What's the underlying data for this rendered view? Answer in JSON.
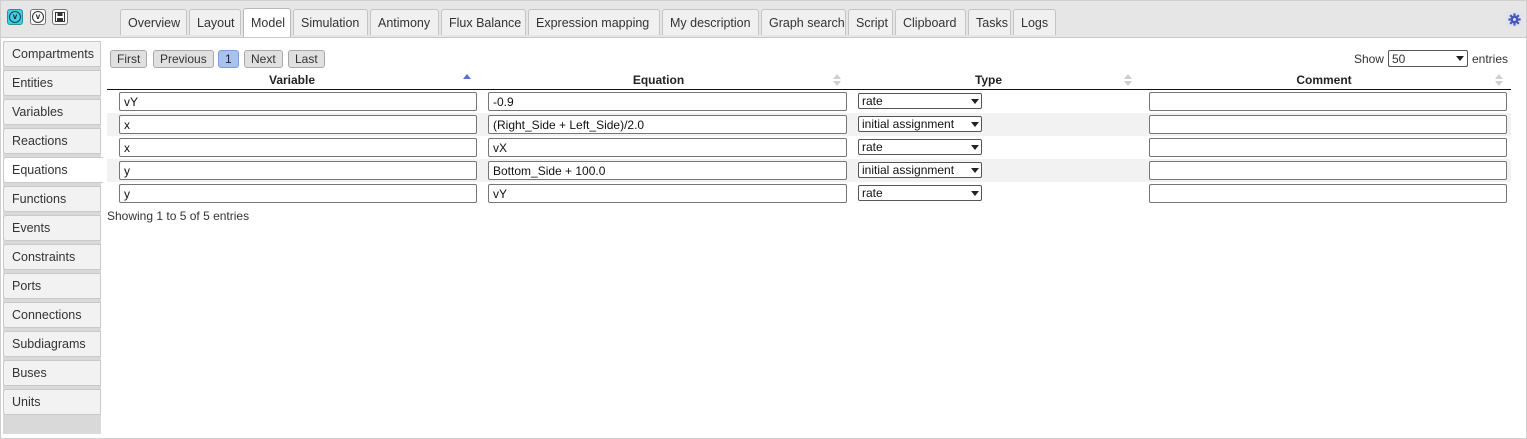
{
  "toolbar": {
    "icons": [
      "vtools-logo-icon",
      "vtools-icon",
      "save-icon"
    ]
  },
  "tabs": [
    "Overview",
    "Layout",
    "Model",
    "Simulation",
    "Antimony",
    "Flux Balance",
    "Expression mapping",
    "My description",
    "Graph search",
    "Script",
    "Clipboard",
    "Tasks",
    "Logs"
  ],
  "active_tab": "Model",
  "sidebar": {
    "items": [
      "Compartments",
      "Entities",
      "Variables",
      "Reactions",
      "Equations",
      "Functions",
      "Events",
      "Constraints",
      "Ports",
      "Connections",
      "Subdiagrams",
      "Buses",
      "Units"
    ],
    "active": "Equations"
  },
  "pager": {
    "first": "First",
    "previous": "Previous",
    "current": "1",
    "next": "Next",
    "last": "Last"
  },
  "length": {
    "show": "Show",
    "value": "50",
    "entries": "entries"
  },
  "table": {
    "columns": [
      "Variable",
      "Equation",
      "Type",
      "Comment"
    ],
    "rows": [
      {
        "variable": "vY",
        "equation": "-0.9",
        "type": "rate",
        "comment": ""
      },
      {
        "variable": "x",
        "equation": "(Right_Side + Left_Side)/2.0",
        "type": "initial assignment",
        "comment": ""
      },
      {
        "variable": "x",
        "equation": "vX",
        "type": "rate",
        "comment": ""
      },
      {
        "variable": "y",
        "equation": "Bottom_Side + 100.0",
        "type": "initial assignment",
        "comment": ""
      },
      {
        "variable": "y",
        "equation": "vY",
        "type": "rate",
        "comment": ""
      }
    ]
  },
  "info": "Showing 1 to 5 of 5 entries",
  "colors": {
    "accent": "#a8c2f0",
    "sort_active": "#5a6fd0",
    "logo": "#3ed0e0"
  }
}
